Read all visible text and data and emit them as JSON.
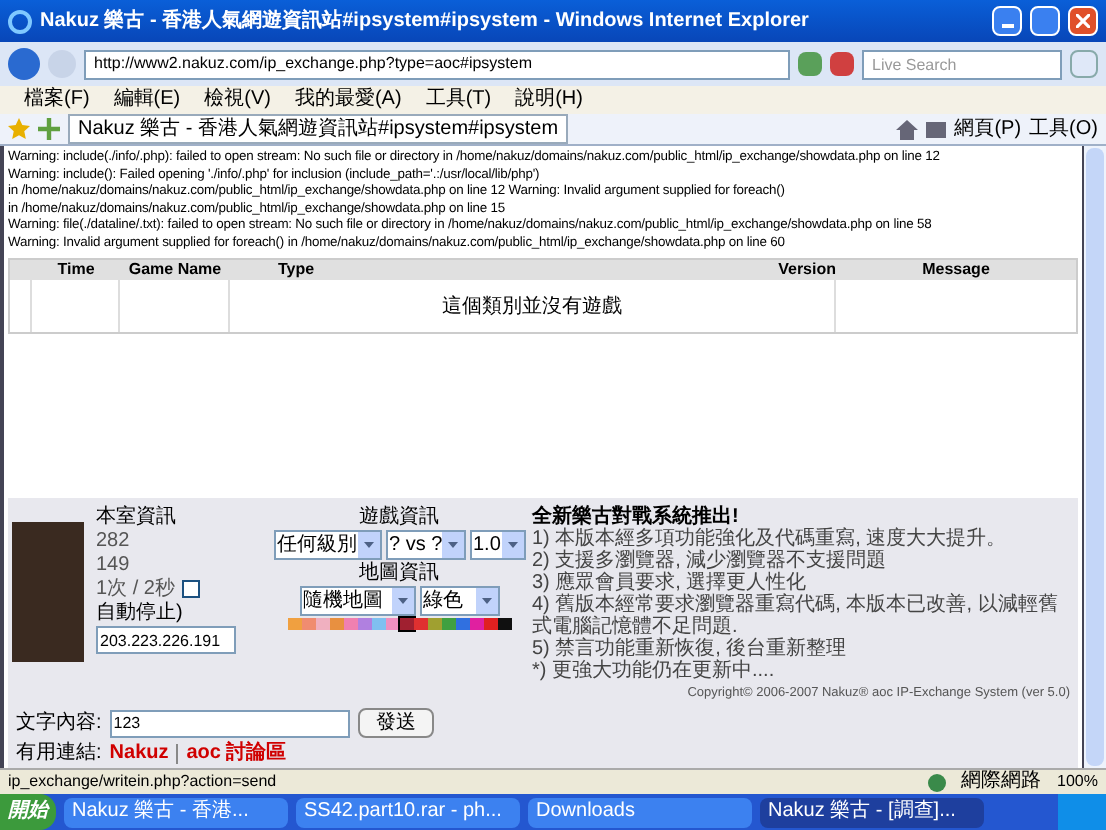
{
  "window": {
    "title": "Nakuz 樂古 - 香港人氣網遊資訊站#ipsystem#ipsystem - Windows Internet Explorer"
  },
  "address_bar": {
    "url": "http://www2.nakuz.com/ip_exchange.php?type=aoc#ipsystem",
    "search_placeholder": "Live Search"
  },
  "menu": [
    "檔案(F)",
    "編輯(E)",
    "檢視(V)",
    "我的最愛(A)",
    "工具(T)",
    "說明(H)"
  ],
  "tabs": [
    {
      "label": "Nakuz 樂古 - 香港人氣網遊資訊站#ipsystem#ipsystem",
      "selected": true
    }
  ],
  "toolbar": [
    "網頁(P)",
    "工具(O)"
  ],
  "warnings": [
    "Warning: include(./info/.php): failed to open stream: No such file or directory in /home/nakuz/domains/nakuz.com/public_html/ip_exchange/showdata.php on line 12",
    "Warning: include(): Failed opening './info/.php' for inclusion (include_path='.:/usr/local/lib/php')",
    "in /home/nakuz/domains/nakuz.com/public_html/ip_exchange/showdata.php on line 12 Warning: Invalid argument supplied for foreach()",
    "in /home/nakuz/domains/nakuz.com/public_html/ip_exchange/showdata.php on line 15",
    "Warning: file(./dataline/.txt): failed to open stream: No such file or directory in /home/nakuz/domains/nakuz.com/public_html/ip_exchange/showdata.php on line 58",
    "Warning: Invalid argument supplied for foreach() in /home/nakuz/domains/nakuz.com/public_html/ip_exchange/showdata.php on line 60"
  ],
  "table": {
    "columns": [
      "Time",
      "Game Name",
      "Type",
      "Version",
      "Message"
    ],
    "empty_message": "這個類別並沒有遊戲"
  },
  "room_info": {
    "title": "本室資訊",
    "values": [
      "282",
      "149"
    ],
    "refresh": "1次 / 2秒",
    "auto_refresh": false,
    "auto_stop": "自動停止)",
    "ip": "203.223.226.191",
    "message_label": "文字內容:",
    "message": "123",
    "send": "發送",
    "links_label": "有用連結:",
    "links": [
      "Nakuz",
      "aoc 討論區"
    ]
  },
  "game_info": {
    "title": "遊戲資訊",
    "selects": [
      "任何級別",
      "? vs ?",
      "1.0"
    ],
    "map_title": "地圖資訊",
    "map_selects": [
      "隨機地圖",
      "綠色"
    ],
    "palette": [
      {
        "color": "#f0a040",
        "selected": false
      },
      {
        "color": "#f08c70",
        "selected": false
      },
      {
        "color": "#f0b0c0",
        "selected": false
      },
      {
        "color": "#e89040",
        "selected": false
      },
      {
        "color": "#f080b0",
        "selected": false
      },
      {
        "color": "#b080e0",
        "selected": false
      },
      {
        "color": "#80c0f0",
        "selected": false
      },
      {
        "color": "#f090c0",
        "selected": false
      },
      {
        "color": "#a02030",
        "selected": true
      },
      {
        "color": "#e03030",
        "selected": false
      },
      {
        "color": "#a0a030",
        "selected": false
      },
      {
        "color": "#40a040",
        "selected": false
      },
      {
        "color": "#3070e0",
        "selected": false
      },
      {
        "color": "#e020a0",
        "selected": false
      },
      {
        "color": "#e02020",
        "selected": false
      },
      {
        "color": "#101010",
        "selected": false
      }
    ]
  },
  "news": {
    "title": "全新樂古對戰系統推出!",
    "items": [
      "1) 本版本經多項功能強化及代碼重寫, 速度大大提升。",
      "2) 支援多瀏覽器, 減少瀏覽器不支援問題",
      "3) 應眾會員要求, 選擇更人性化",
      "4) 舊版本經常要求瀏覽器重寫代碼, 本版本已改善, 以減輕舊式電腦記憶體不足問題.",
      "5) 禁言功能重新恢復, 後台重新整理",
      "*) 更強大功能仍在更新中...."
    ],
    "copyright": "Copyright© 2006-2007 Nakuz® aoc IP-Exchange System (ver 5.0)"
  },
  "status_bar": {
    "url": "ip_exchange/writein.php?action=send",
    "zone": "網際網路",
    "zoom": "100%"
  },
  "taskbar": {
    "start": "開始",
    "tasks": [
      {
        "label": "Nakuz 樂古 - 香港...",
        "selected": false
      },
      {
        "label": "SS42.part10.rar - ph...",
        "selected": false
      },
      {
        "label": "Downloads",
        "selected": false
      },
      {
        "label": "Nakuz 樂古 - [調查]...",
        "selected": true
      }
    ]
  }
}
